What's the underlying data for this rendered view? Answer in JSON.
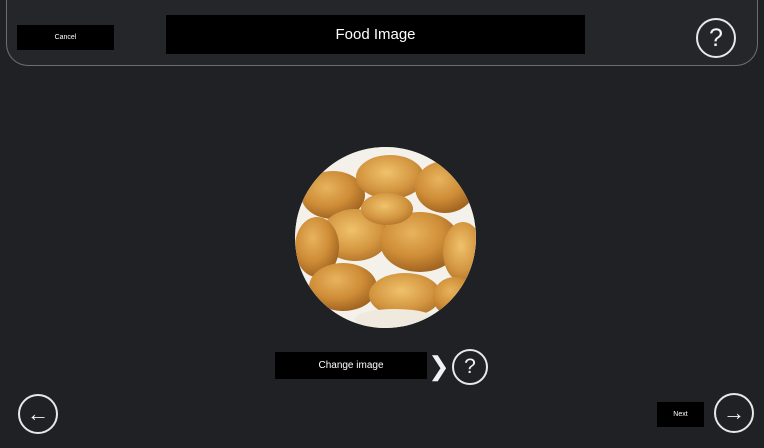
{
  "header": {
    "cancel_label": "Cancel",
    "title": "Food Image",
    "help_glyph": "?"
  },
  "main": {
    "image_description_icon": "chicken-nuggets-photo",
    "change_image_label": "Change image",
    "chevron_glyph": "❯",
    "help_glyph": "?"
  },
  "footer": {
    "back_glyph": "←",
    "next_label": "Next",
    "next_glyph": "→"
  },
  "colors": {
    "background": "#1f2124",
    "label_bg": "#000000",
    "text": "#ffffff",
    "nugget": "#d59a45"
  }
}
